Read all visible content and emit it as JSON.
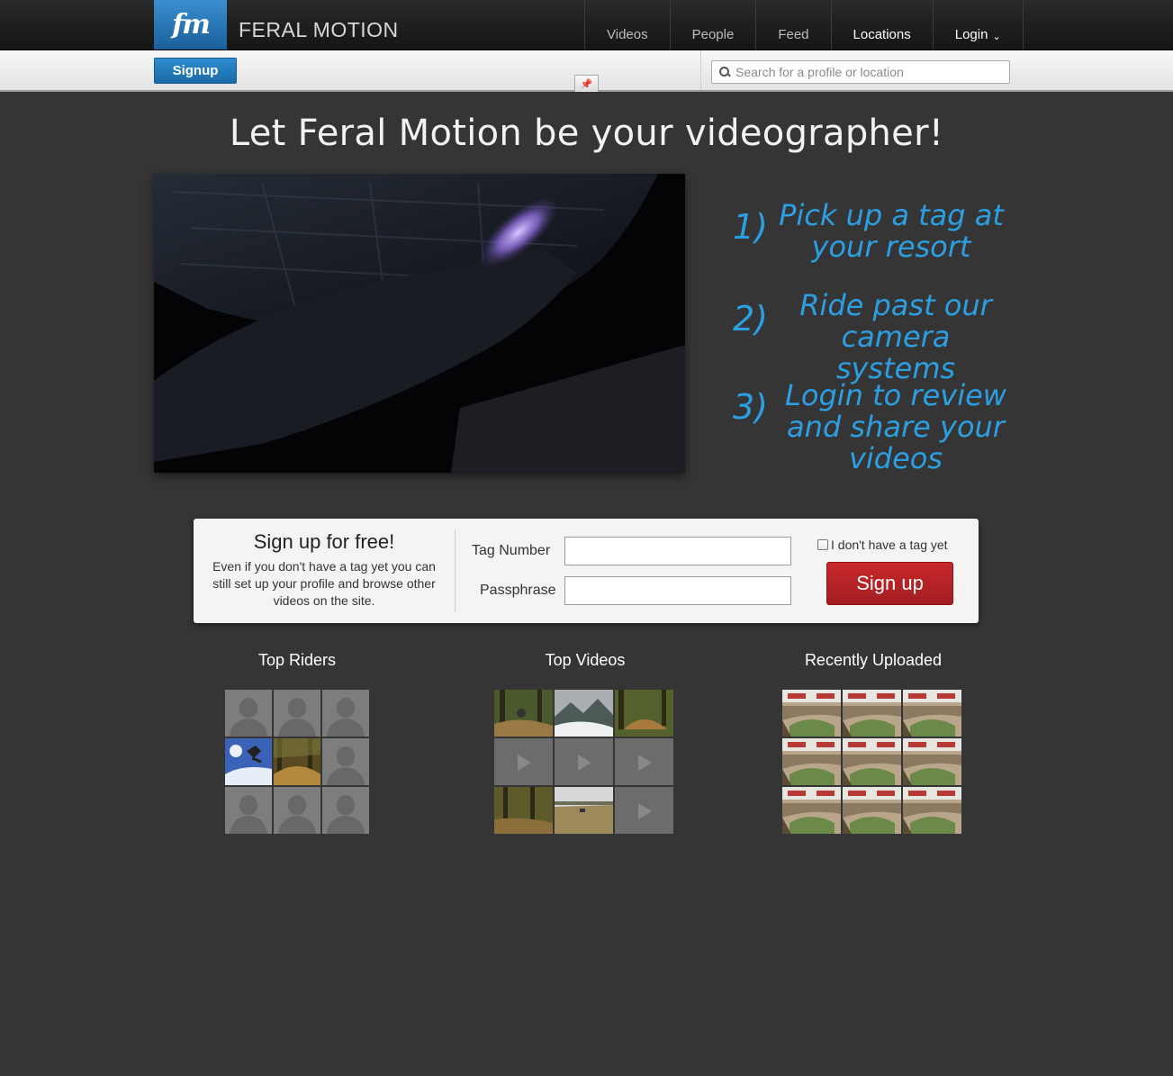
{
  "brand": {
    "logo_text": "fm",
    "name": "FERAL MOTION"
  },
  "nav": {
    "items": [
      {
        "label": "Videos"
      },
      {
        "label": "People"
      },
      {
        "label": "Feed"
      },
      {
        "label": "Locations"
      },
      {
        "label": "Login"
      }
    ]
  },
  "subbar": {
    "signup_label": "Signup",
    "search_placeholder": "Search for a profile or location"
  },
  "hero": {
    "title": "Let Feral Motion be your videographer!",
    "steps": [
      {
        "num": "1)",
        "text": "Pick up a tag at your resort"
      },
      {
        "num": "2)",
        "text": "Ride past our camera systems"
      },
      {
        "num": "3)",
        "text": "Login to review and share your videos"
      }
    ]
  },
  "signup_panel": {
    "heading": "Sign up for free!",
    "description": "Even if you don't have a tag yet you can still set up your profile and browse other videos on the site.",
    "tag_label": "Tag Number",
    "pass_label": "Passphrase",
    "no_tag_label": "I don't have a tag yet",
    "button_label": "Sign up"
  },
  "sections": {
    "top_riders": "Top Riders",
    "top_videos": "Top Videos",
    "recently_uploaded": "Recently Uploaded"
  },
  "colors": {
    "accent_blue": "#2c9fe3",
    "signup_red": "#b82326",
    "background": "#353535"
  }
}
